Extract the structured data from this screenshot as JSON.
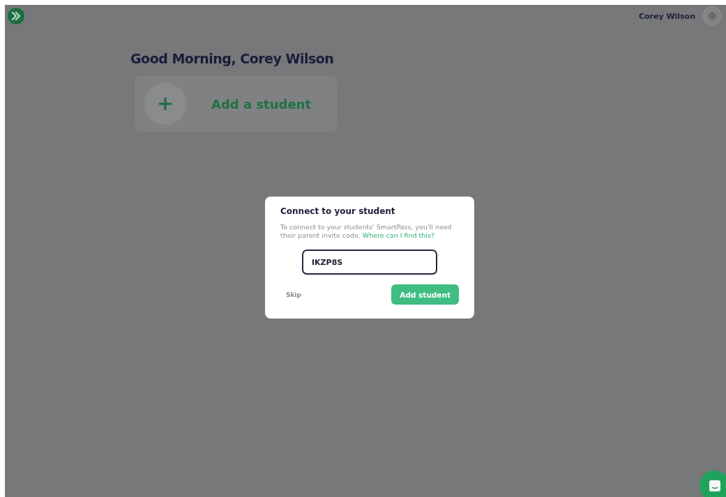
{
  "header": {
    "user_name": "Corey Wilson"
  },
  "greeting": "Good Morning, Corey Wilson",
  "add_card": {
    "label": "Add a student"
  },
  "dialog": {
    "title": "Connect to your student",
    "body": "To connect to your students' SmartPass, you'll need their parent invite code.",
    "help_link": "Where can I find this?",
    "code_field": {
      "value": "IKZP8S"
    },
    "skip": "Skip",
    "submit": "Add student"
  }
}
